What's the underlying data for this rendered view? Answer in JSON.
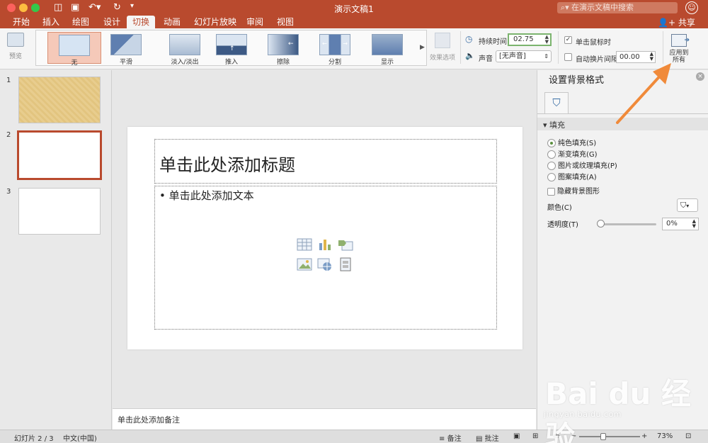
{
  "window": {
    "title": "演示文稿1",
    "search_placeholder": "在演示文稿中搜索"
  },
  "tabs": [
    {
      "label": "开始"
    },
    {
      "label": "插入"
    },
    {
      "label": "绘图"
    },
    {
      "label": "设计"
    },
    {
      "label": "切换"
    },
    {
      "label": "动画"
    },
    {
      "label": "幻灯片放映"
    },
    {
      "label": "审阅"
    },
    {
      "label": "视图"
    }
  ],
  "share_label": "共享",
  "ribbon": {
    "preview_label": "预览",
    "transitions": [
      {
        "label": "无"
      },
      {
        "label": "平滑"
      },
      {
        "label": "淡入/淡出"
      },
      {
        "label": "推入"
      },
      {
        "label": "擦除"
      },
      {
        "label": "分割"
      },
      {
        "label": "显示"
      }
    ],
    "effect_options_label": "效果选项",
    "duration_label": "持续时间:",
    "duration_value": "02.75",
    "sound_label": "声音",
    "sound_value": "[无声音]",
    "on_click_label": "单击鼠标时",
    "after_label": "自动换片间隔:",
    "after_value": "00.00",
    "apply_all_label_1": "应用到",
    "apply_all_label_2": "所有"
  },
  "slides": [
    {
      "number": "1"
    },
    {
      "number": "2"
    },
    {
      "number": "3"
    }
  ],
  "slide": {
    "title_placeholder": "单击此处添加标题",
    "body_placeholder": "• 单击此处添加文本"
  },
  "notes_placeholder": "单击此处添加备注",
  "format_pane": {
    "title": "设置背景格式",
    "section": "填充",
    "options": [
      {
        "label": "纯色填充(S)"
      },
      {
        "label": "渐变填充(G)"
      },
      {
        "label": "图片或纹理填充(P)"
      },
      {
        "label": "图案填充(A)"
      }
    ],
    "hide_bg_label": "隐藏背景图形",
    "color_label": "颜色(C)",
    "transparency_label": "透明度(T)",
    "transparency_value": "0%",
    "transparency_level": 0
  },
  "status": {
    "slide_info": "幻灯片 2 / 3",
    "language": "中文(中国)",
    "notes_btn": "备注",
    "comments_btn": "批注",
    "zoom": "73%"
  },
  "watermark": {
    "logo": "Bai du 经验",
    "url": "jingyan.baidu.com"
  },
  "colors": {
    "accent": "#b94a2e",
    "radio_on": "#5b8f3f",
    "duration_border": "#7bb46e",
    "annotation_arrow": "#f08a3a"
  }
}
